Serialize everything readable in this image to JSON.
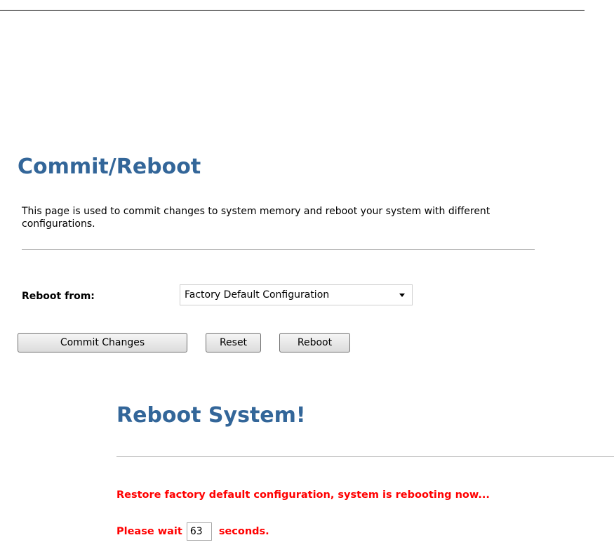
{
  "page": {
    "title": "Commit/Reboot",
    "description": "This page is used to commit changes to system memory and reboot your system with different configurations."
  },
  "reboot_from": {
    "label": "Reboot from:",
    "selected": "Factory Default Configuration"
  },
  "buttons": {
    "commit": "Commit Changes",
    "reset": "Reset",
    "reboot": "Reboot"
  },
  "reboot_panel": {
    "title": "Reboot System!",
    "message": "Restore factory default configuration, system is rebooting now...",
    "wait_prefix": "Please wait",
    "seconds_value": "63",
    "wait_suffix": "seconds."
  },
  "colors": {
    "heading": "#336699",
    "alert": "#ff0000"
  },
  "icons": {
    "dropdown": "chevron-down-icon"
  }
}
